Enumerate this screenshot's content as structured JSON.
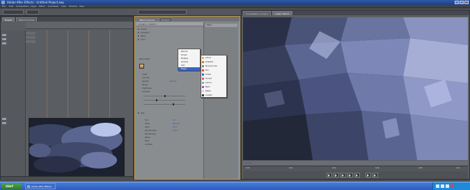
{
  "window": {
    "title": "Adobe After Effects - Untitled Project.aep"
  },
  "menu": [
    "File",
    "Edit",
    "Composition",
    "Layer",
    "Effect",
    "Animation",
    "View",
    "Window",
    "Help"
  ],
  "left_panel": {
    "tabs": [
      "Project",
      "Effect Controls"
    ],
    "rows": [
      "Comp 1",
      "Solid 1",
      "Footage"
    ]
  },
  "mid_panel": {
    "tabs": [
      "Effect Controls",
      "Comp 1"
    ],
    "header": "Comp 1 • Solid 1",
    "side_header": "Effect",
    "rows": [
      "Fractal",
      "Transform",
      "Effect",
      "Color",
      "Blend Mode",
      "Invert",
      "Colorize",
      "Opacity",
      "Range",
      "Brightness",
      "Contrast",
      "Size",
      "Cell",
      "Scale",
      "Seed",
      "Randomness",
      "Smoothness",
      "Phase",
      "Fade",
      "Animate"
    ],
    "values": [
      "Screen",
      "Normal",
      "0.0",
      "100.0%",
      "50.0",
      "100.0"
    ]
  },
  "popup_left": {
    "items": [
      "Normal",
      "Screen",
      "Multiply",
      "Overlay",
      "Add",
      "Edges"
    ],
    "selected_index": 5
  },
  "popup_right": {
    "items": [
      "Colors",
      "Gradient",
      "Monochrome",
      "Fire",
      "Ocean",
      "Sunset",
      "Aurora",
      "Neon",
      "Pastel",
      "Custom"
    ]
  },
  "right_panel": {
    "tabs": [
      "Composition: Comp 1",
      "Layer: Solid 1"
    ],
    "bar_label": "Comp 1",
    "ticks": [
      "0:00",
      "0:02",
      "0:04",
      "0:06",
      "0:08",
      "0:10"
    ]
  },
  "taskbar": {
    "start": "start",
    "item": "Adobe After Effects"
  },
  "colors": {
    "accent": "#c0943c",
    "selection": "#3a62c4",
    "taskbar": "#2a5ac0"
  }
}
